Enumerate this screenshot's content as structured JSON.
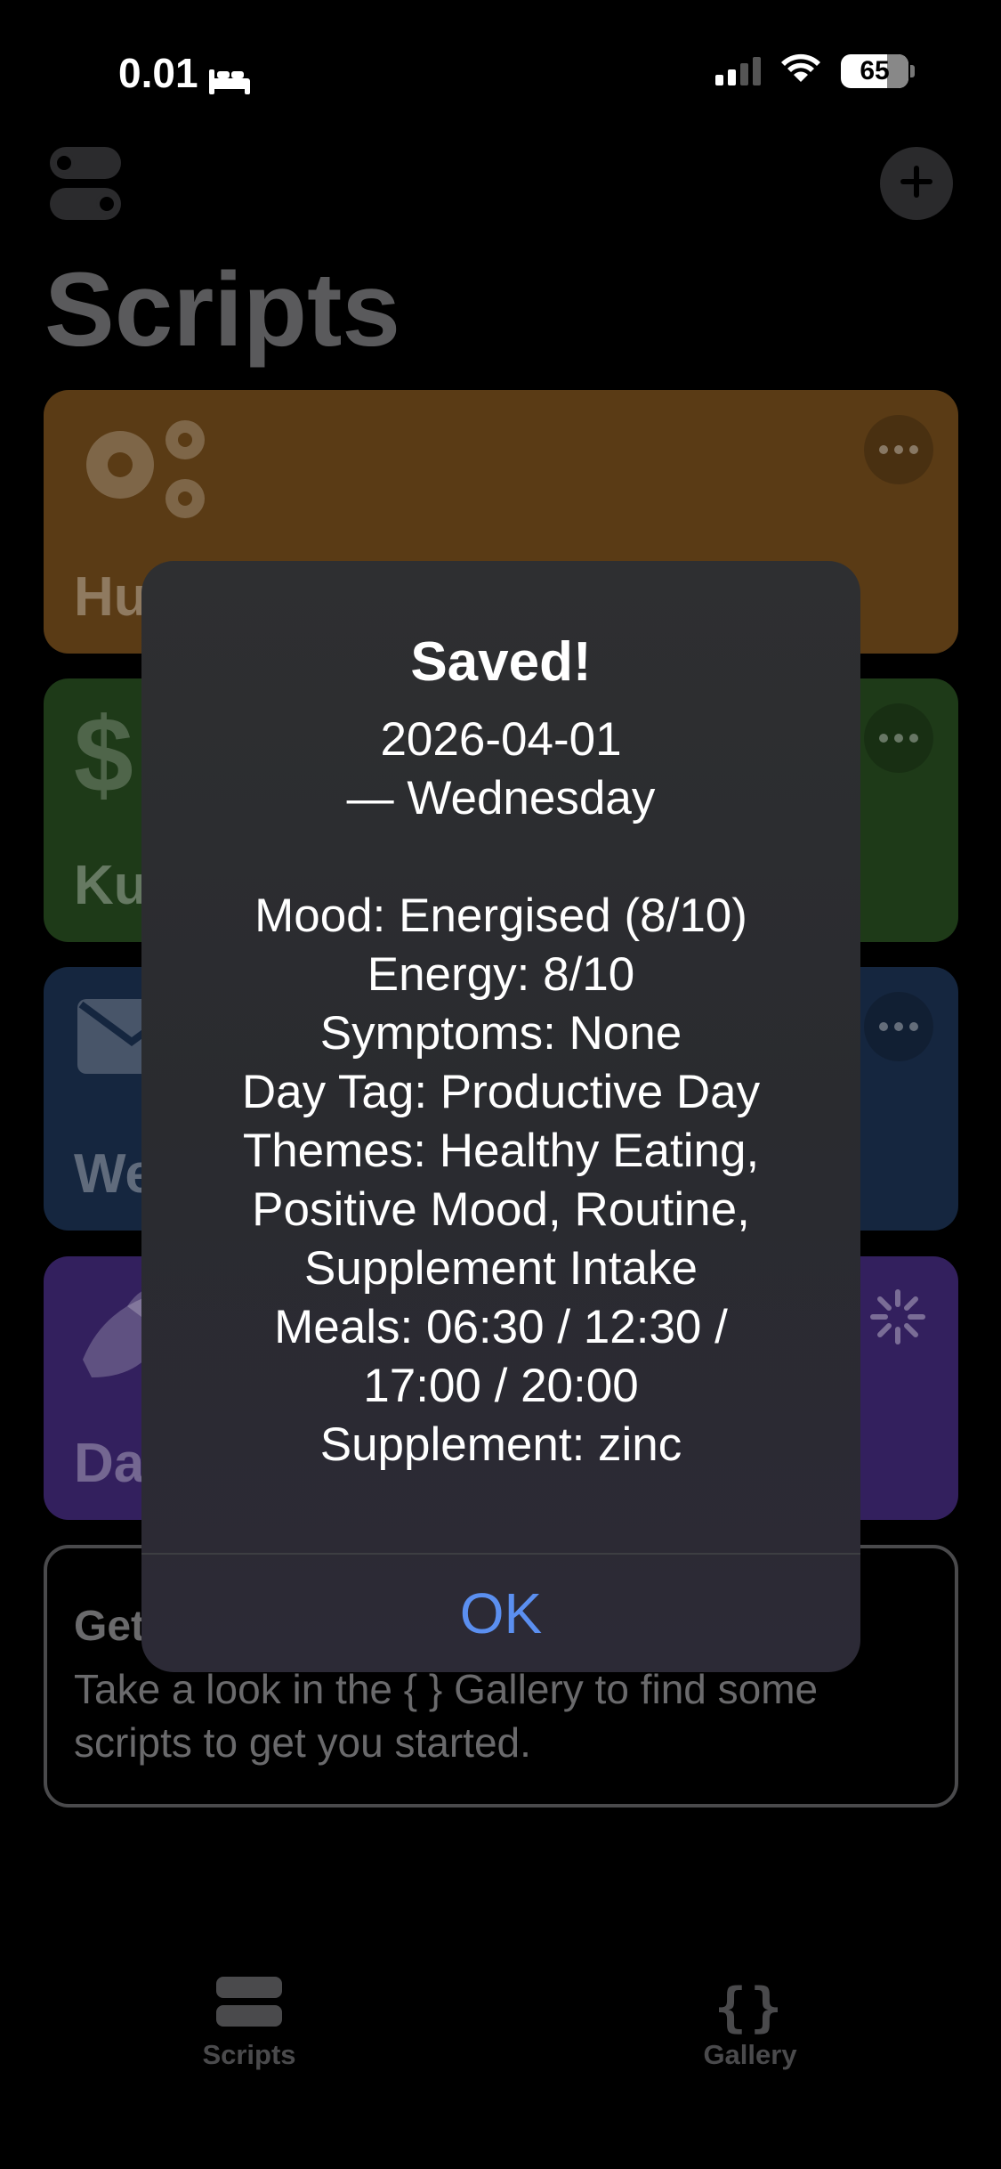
{
  "status_bar": {
    "time": "0.01",
    "battery": "65"
  },
  "header": {
    "title": "Scripts"
  },
  "cards": [
    {
      "title": "Hu",
      "color": "#5a3b15"
    },
    {
      "title": "Ku",
      "color": "#1e3a18"
    },
    {
      "title": "We",
      "color": "#15263f"
    },
    {
      "title": "Da",
      "color": "#33205e"
    }
  ],
  "get_started": {
    "title": "Get",
    "text": "Take a look in the { } Gallery to find some scripts to get you started."
  },
  "alert": {
    "title": "Saved!",
    "message": "2026-04-01\n— Wednesday\n\nMood: Energised (8/10)\nEnergy: 8/10\nSymptoms: None\nDay Tag: Productive Day\nThemes: Healthy Eating,\nPositive Mood, Routine,\nSupplement Intake\nMeals: 06:30 / 12:30 /\n17:00 / 20:00\nSupplement: zinc",
    "ok_label": "OK"
  },
  "tabs": [
    {
      "label": "Scripts"
    },
    {
      "label": "Gallery"
    }
  ]
}
